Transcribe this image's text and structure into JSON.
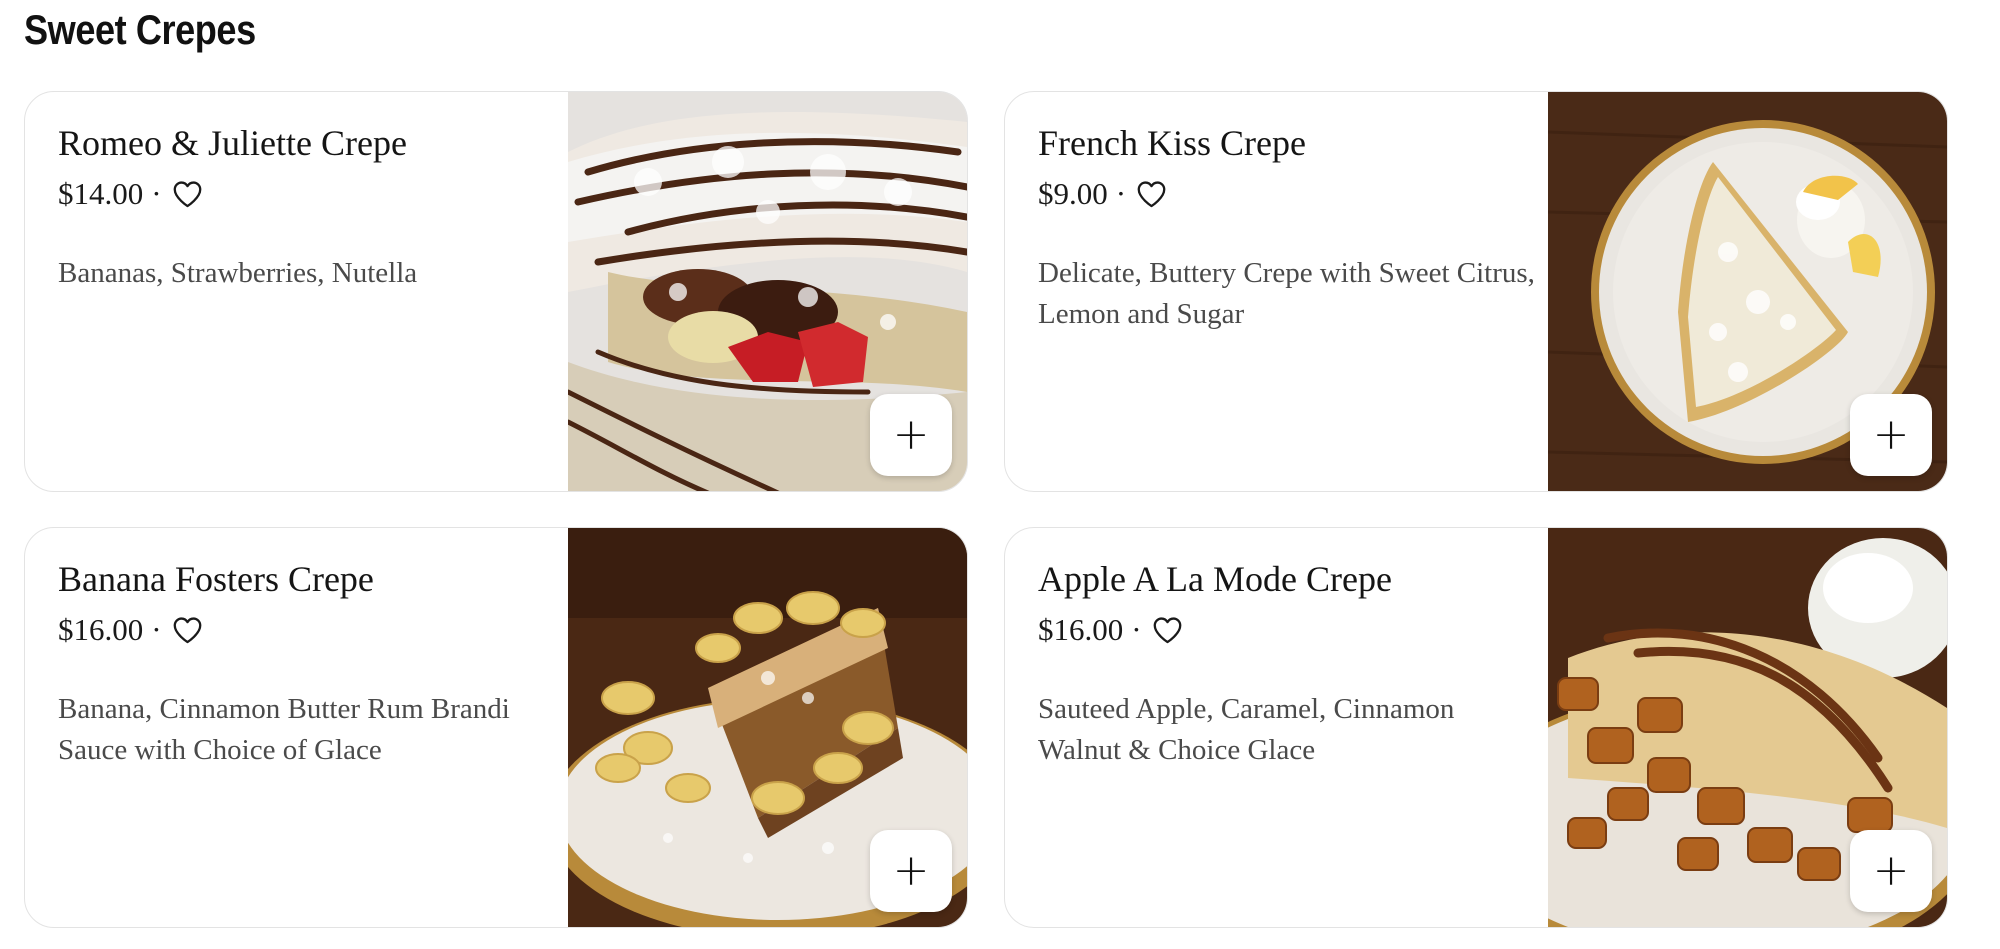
{
  "section": {
    "title": "Sweet Crepes"
  },
  "items": [
    {
      "name": "Romeo & Juliette Crepe",
      "price": "$14.00",
      "separator": "·",
      "description": "Bananas, Strawberries, Nutella",
      "favorite_icon": "heart-outline-icon",
      "add_icon": "plus-icon",
      "add_label": "+"
    },
    {
      "name": "French Kiss Crepe",
      "price": "$9.00",
      "separator": "·",
      "description": "Delicate, Buttery Crepe with Sweet Citrus, Lemon and Sugar",
      "favorite_icon": "heart-outline-icon",
      "add_icon": "plus-icon",
      "add_label": "+"
    },
    {
      "name": "Banana Fosters Crepe",
      "price": "$16.00",
      "separator": "·",
      "description": "Banana, Cinnamon Butter Rum Brandi Sauce with Choice of Glace",
      "favorite_icon": "heart-outline-icon",
      "add_icon": "plus-icon",
      "add_label": "+"
    },
    {
      "name": "Apple A La Mode Crepe",
      "price": "$16.00",
      "separator": "·",
      "description": "Sauteed Apple, Caramel, Cinnamon Walnut & Choice Glace",
      "favorite_icon": "heart-outline-icon",
      "add_icon": "plus-icon",
      "add_label": "+"
    }
  ],
  "colors": {
    "card_border": "#e3e3e3",
    "text_primary": "#151515",
    "text_secondary": "#4a4a4a",
    "wood": "#4a2a17",
    "plate_rim": "#b88a3a"
  }
}
